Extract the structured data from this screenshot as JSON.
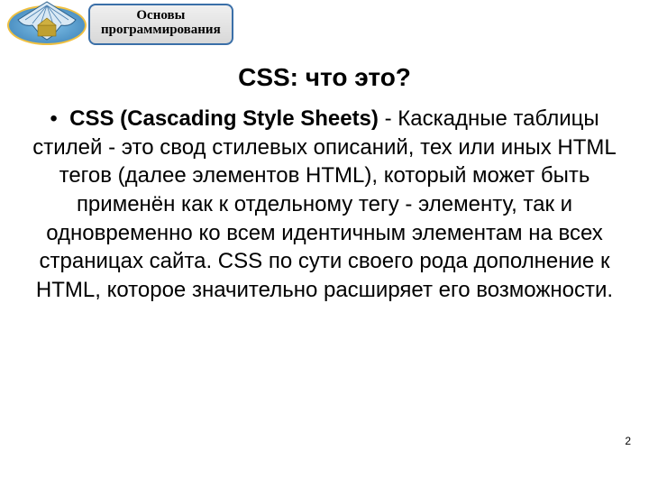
{
  "badge": {
    "line1": "Основы",
    "line2": "программирования"
  },
  "title": "CSS: что это?",
  "bullet": {
    "marker": "•",
    "bold_lead": "CSS (Cascading Style Sheets)",
    "rest": " - Каскадные таблицы стилей - это свод стилевых описаний, тех или иных HTML тегов (далее элементов HTML), который может быть применён как к отдельному тегу - элементу, так и одновременно ко всем идентичным элементам на всех страницах сайта. CSS по сути своего рода дополнение к HTML, которое значительно расширяет его возможности."
  },
  "page_number": "2"
}
